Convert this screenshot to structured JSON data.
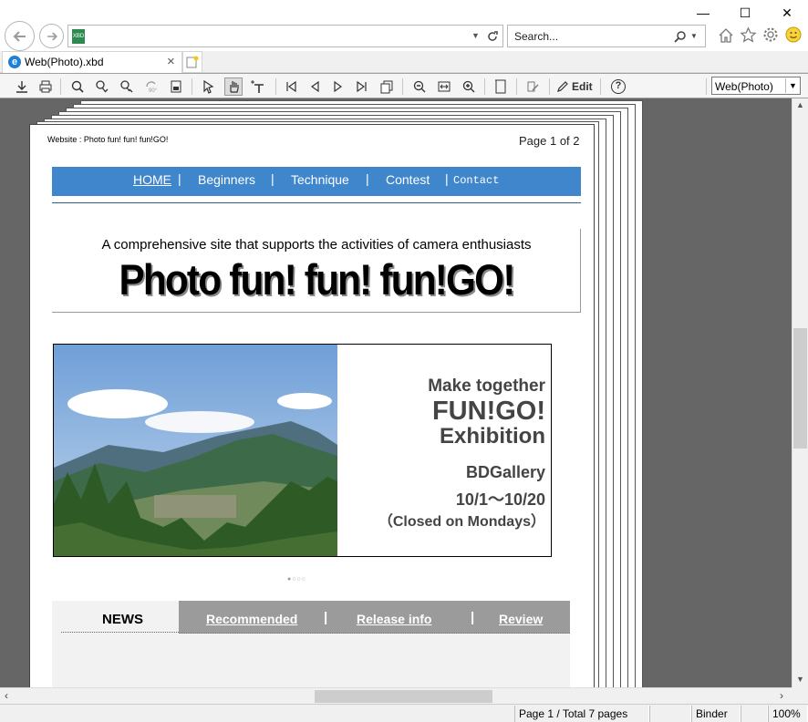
{
  "window": {
    "minimize_glyph": "—",
    "maximize_glyph": "☐",
    "close_glyph": "✕"
  },
  "address": {
    "value": "",
    "search_placeholder": "Search...",
    "file_badge": "XBD"
  },
  "tab": {
    "title": "Web(Photo).xbd",
    "close_glyph": "×"
  },
  "toolbar": {
    "edit_label": "Edit",
    "help_glyph": "?",
    "view_select": "Web(Photo)"
  },
  "page": {
    "header_left": "Website : Photo fun! fun! fun!GO!",
    "header_right": "Page 1 of 2",
    "menu": [
      {
        "label": "HOME"
      },
      {
        "label": "Beginners"
      },
      {
        "label": "Technique"
      },
      {
        "label": "Contest"
      },
      {
        "label": "Contact"
      }
    ],
    "menu_separator": "|",
    "tagline": "A comprehensive site that supports the activities of camera enthusiasts",
    "site_title": "Photo fun! fun! fun!GO!",
    "banner": {
      "line1": "Make together",
      "line2": "FUN!GO!",
      "line3": "Exhibition",
      "line4": "BDGallery",
      "line5": "10/1～10/20",
      "line6": "（Closed on Mondays）"
    },
    "carousel_dots": "●○○○",
    "news": {
      "active_tab": "NEWS",
      "tabs": [
        "Recommended",
        "Release info",
        "Review"
      ],
      "separator": "|"
    }
  },
  "status": {
    "pages": "Page 1 / Total 7 pages",
    "binder": "Binder",
    "zoom": "100%"
  },
  "colors": {
    "menu_bar": "#3f86cc",
    "news_tab_bar": "#9b9b9b",
    "viewer_bg": "#666666"
  }
}
